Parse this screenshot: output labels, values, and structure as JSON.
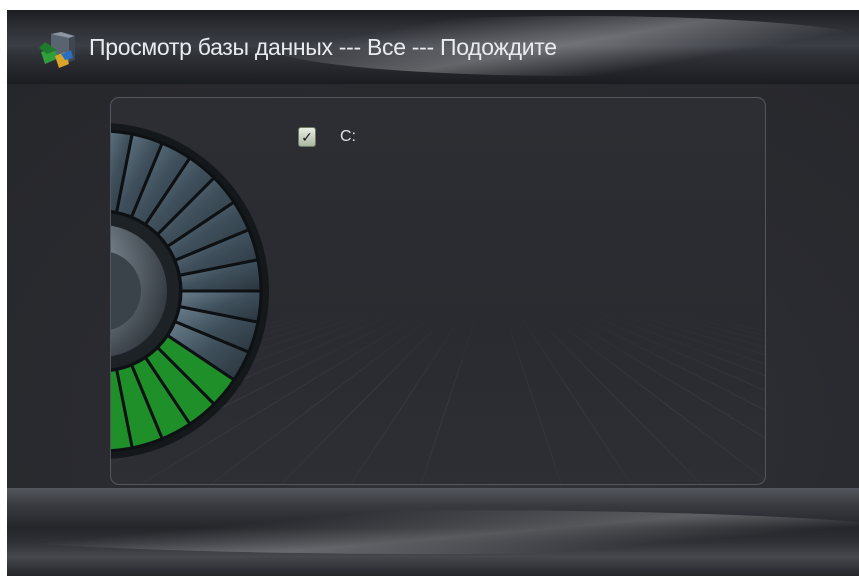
{
  "window": {
    "title": "Просмотр базы данных --- Все --- Подождите"
  },
  "drives": [
    {
      "label": "C:",
      "checked": true,
      "check_glyph": "✓"
    }
  ],
  "progress": {
    "icon": "disk-progress-icon",
    "total_segments": 16,
    "filled_segments": 5,
    "filled_color": "#1f8f2a",
    "empty_color": "#3a4a56"
  },
  "icons": {
    "app": "database-app-icon",
    "check": "checkmark-icon"
  }
}
